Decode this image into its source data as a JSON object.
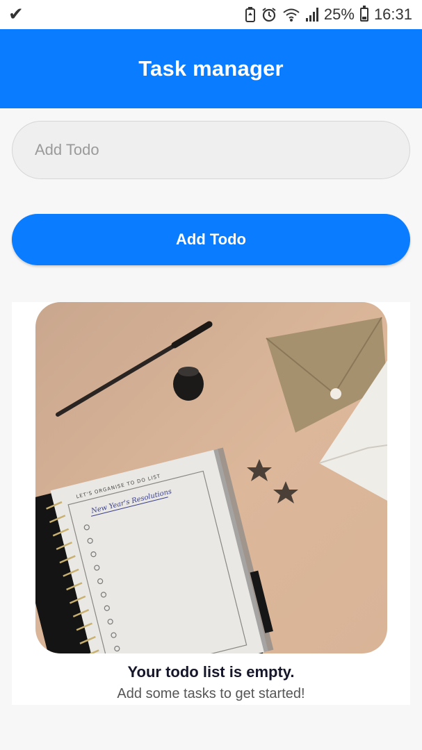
{
  "status_bar": {
    "left_icon": "check-icon",
    "battery_percent": "25%",
    "time": "16:31"
  },
  "header": {
    "title": "Task manager"
  },
  "input": {
    "placeholder": "Add Todo",
    "value": ""
  },
  "add_button": {
    "label": "Add Todo"
  },
  "empty_state": {
    "image": "desk-notebook-illustration",
    "title": "Your todo list is empty.",
    "subtitle": "Add some tasks to get started!"
  },
  "colors": {
    "primary": "#0a7cff",
    "background": "#f7f7f7",
    "text_dark": "#16162b"
  }
}
